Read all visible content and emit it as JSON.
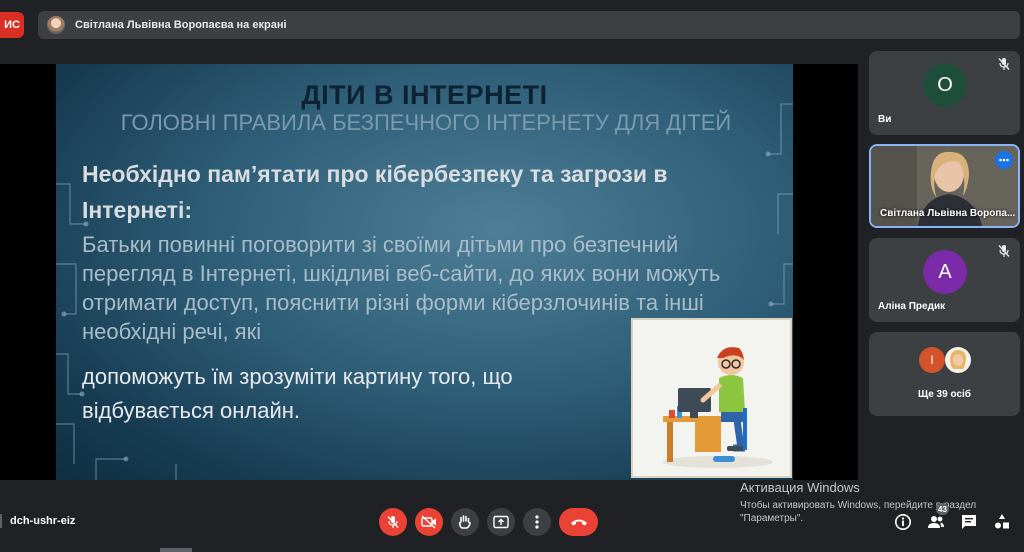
{
  "recording_badge": "ИС",
  "presenting_bar": {
    "text": "Світлана Львівна Воропаєва на екрані"
  },
  "slide": {
    "title": "ДІТИ В ІНТЕРНЕТІ",
    "subtitle": "ГОЛОВНІ ПРАВИЛА БЕЗПЕЧНОГО ІНТЕРНЕТУ ДЛЯ ДІТЕЙ",
    "body1": "Необхідно пам’ятати про кібербезпеку та загрози в Інтернеті:",
    "body2": "Батьки повинні поговорити зі своїми дітьми про безпечний перегляд в Інтернеті, шкідливі веб-сайти, до яких вони можуть отримати доступ, пояснити різні форми кіберзлочинів та інші необхідні речі, які",
    "body3": "допоможуть їм зрозуміти картину того, що відбувається онлайн."
  },
  "participants": [
    {
      "initial": "О",
      "name": "Ви",
      "color": "#1e4d3a",
      "muted": true
    },
    {
      "name": "Світлана Львівна Воропа...",
      "video": true
    },
    {
      "initial": "A",
      "name": "Аліна Предик",
      "color": "#7b2ba8",
      "muted": true
    }
  ],
  "others": {
    "initial": "І",
    "initial_color": "#d4532a",
    "label": "Ще 39 осіб"
  },
  "meeting_code": "dch-ushr-eiz",
  "people_count": "43",
  "windows_activation": {
    "title": "Активация Windows",
    "text": "Чтобы активировать Windows, перейдите в раздел \"Параметры\"."
  },
  "icons": [
    "mic-off-icon",
    "camera-off-icon",
    "raise-hand-icon",
    "present-screen-icon",
    "more-options-icon",
    "hang-up-icon",
    "info-icon",
    "people-icon",
    "chat-icon",
    "activities-icon"
  ]
}
